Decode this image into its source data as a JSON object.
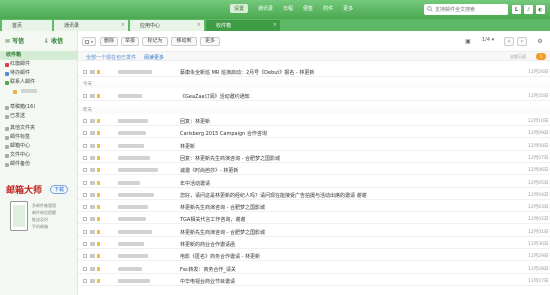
{
  "top_menu": [
    "设置",
    "通讯录",
    "日程",
    "便签",
    "附件",
    "更多"
  ],
  "top_menu_active": 0,
  "search": {
    "placeholder": "支持邮件全文搜索"
  },
  "top_icons": [
    "L",
    "♪",
    "◐"
  ],
  "tabs": [
    {
      "label": "首页"
    },
    {
      "label": "通讯录"
    },
    {
      "label": "应用中心"
    },
    {
      "label": "收件箱"
    }
  ],
  "sidebar": {
    "compose": "写信",
    "receive": "收信",
    "items": [
      {
        "label": "收件箱",
        "selected": true
      },
      {
        "label": "红旗邮件",
        "icon_color": "#e04040"
      },
      {
        "label": "待办邮件",
        "icon_color": "#4a90d0"
      },
      {
        "label": "联系人邮件",
        "icon_color": "#4aa84f"
      },
      {
        "label": "",
        "sub": true,
        "icon_color": "#f0b040"
      },
      {
        "label": "草稿箱(16)",
        "icon_color": "#aaa"
      },
      {
        "label": "已发送",
        "icon_color": "#aaa"
      },
      {
        "label": "其他文件夹",
        "icon_color": "#aaa"
      },
      {
        "label": "邮件标签",
        "icon_color": "#aaa"
      },
      {
        "label": "邮箱中心",
        "icon_color": "#aaa"
      },
      {
        "label": "文件中心",
        "icon_color": "#aaa"
      },
      {
        "label": "邮件备份",
        "icon_color": "#aaa"
      }
    ]
  },
  "promo": {
    "brand": "邮箱大师",
    "download": "下载",
    "features": [
      "多邮件集管理",
      "邮件新信提醒",
      "推送及时",
      "手机邮箱"
    ]
  },
  "toolbar": {
    "buttons": [
      "删除",
      "举报",
      "标记为",
      "移动到",
      "更多"
    ],
    "page": "1/4",
    "page_arrow": "▾",
    "prev": "‹",
    "next": "›",
    "icons": [
      "▣",
      "⚙"
    ]
  },
  "notice": {
    "text": "全部一个现在也已发件",
    "link": "阅读更多",
    "right": "全部已读",
    "badge": "1"
  },
  "groups": [
    {
      "label": "今天"
    },
    {
      "label": "昨天"
    },
    {
      "label": "更早"
    }
  ],
  "emails": [
    {
      "sender_w": 34,
      "subject": "蔡康永全新巡 MR 巡演启动：2月号《Debut》报名 - 林更新",
      "date": "11月26日"
    },
    {
      "sender_w": 24,
      "subject": "《GeaZaa订阅》活动邀约通知",
      "date": "11月25日"
    },
    {
      "sender_w": 30,
      "subject": "回复：林更新",
      "date": "12月10日"
    },
    {
      "sender_w": 28,
      "subject": "Carlsberg 2015 Campaign 合作咨询",
      "date": "12月09日"
    },
    {
      "sender_w": 26,
      "subject": "林更新",
      "date": "12月08日"
    },
    {
      "sender_w": 32,
      "subject": "回复：林更新先生商演咨询 - 合肥梦之国影城",
      "date": "12月07日"
    },
    {
      "sender_w": 40,
      "subject": "诚邀《时尚芭莎》- 林更新",
      "date": "12月06日"
    },
    {
      "sender_w": 22,
      "subject": "年中活动邀请",
      "date": "12月05日"
    },
    {
      "sender_w": 36,
      "subject": "您好，请问这是林更新的经纪人吗？请问现在能接受广告拍摄与活动出席的邀请 谢谢",
      "date": "12月04日"
    },
    {
      "sender_w": 30,
      "subject": "林更新先生商演咨询 - 合肥梦之国影城",
      "date": "12月03日"
    },
    {
      "sender_w": 28,
      "subject": "TGA相关代言工作咨询，谢谢",
      "date": "12月02日"
    },
    {
      "sender_w": 34,
      "subject": "林更新先生商演咨询 - 合肥梦之国影城",
      "date": "12月01日"
    },
    {
      "sender_w": 26,
      "subject": "林更新的商业合作邀请函",
      "date": "11月30日"
    },
    {
      "sender_w": 30,
      "subject": "电影《匿名》商务合作邀请 - 林更新",
      "date": "11月29日"
    },
    {
      "sender_w": 24,
      "subject": "Fw:转发：商务合作_请关",
      "date": "11月28日"
    },
    {
      "sender_w": 32,
      "subject": "中华电视台商业节目邀请",
      "date": "11月27日"
    }
  ]
}
